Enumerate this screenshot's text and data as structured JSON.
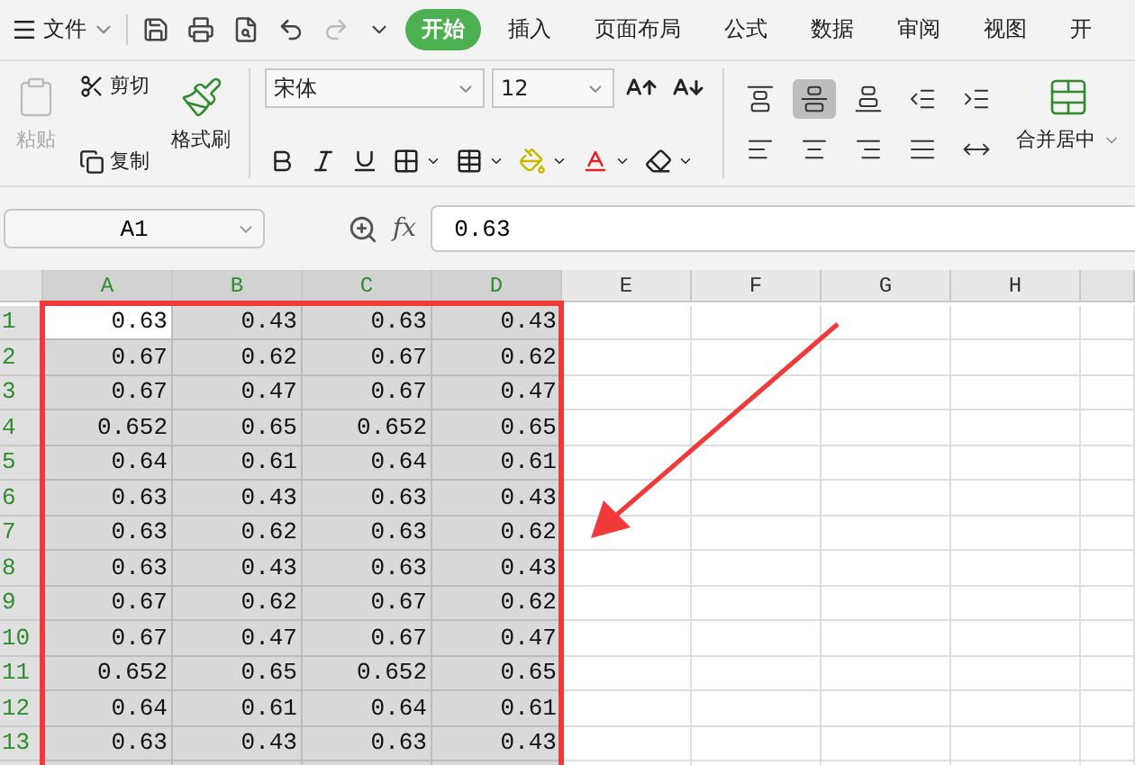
{
  "menu": {
    "file_label": "文件",
    "tabs": [
      {
        "label": "开始",
        "selected": true
      },
      {
        "label": "插入",
        "selected": false
      },
      {
        "label": "页面布局",
        "selected": false
      },
      {
        "label": "公式",
        "selected": false
      },
      {
        "label": "数据",
        "selected": false
      },
      {
        "label": "审阅",
        "selected": false
      },
      {
        "label": "视图",
        "selected": false
      },
      {
        "label": "开",
        "selected": false
      }
    ]
  },
  "clipboard": {
    "paste": {
      "label": "粘贴",
      "disabled": true
    },
    "cut": "剪切",
    "copy": "复制",
    "format_painter": "格式刷"
  },
  "font": {
    "name": "宋体",
    "size": "12"
  },
  "alignment": [
    {
      "kind": "top",
      "selected": false
    },
    {
      "kind": "middle",
      "selected": true
    },
    {
      "kind": "bottom",
      "selected": false
    },
    {
      "kind": "outdent",
      "selected": false
    },
    {
      "kind": "indent",
      "selected": false
    },
    {
      "kind": "left",
      "selected": false
    },
    {
      "kind": "center",
      "selected": false
    },
    {
      "kind": "right",
      "selected": false
    },
    {
      "kind": "justify",
      "selected": false
    },
    {
      "kind": "distribute",
      "selected": false
    }
  ],
  "merge_label": "合并居中",
  "formula_bar": {
    "name_box": "A1",
    "function_label": "fx",
    "value": "0.63"
  },
  "columns": [
    {
      "label": "A",
      "selected": true
    },
    {
      "label": "B",
      "selected": true
    },
    {
      "label": "C",
      "selected": true
    },
    {
      "label": "D",
      "selected": true
    },
    {
      "label": "E",
      "selected": false
    },
    {
      "label": "F",
      "selected": false
    },
    {
      "label": "G",
      "selected": false
    },
    {
      "label": "H",
      "selected": false
    }
  ],
  "rows": [
    {
      "label": "1",
      "selected": true,
      "cells": [
        {
          "value": "0.63",
          "active": true
        },
        {
          "value": "0.43",
          "active": false
        },
        {
          "value": "0.63",
          "active": false
        },
        {
          "value": "0.43",
          "active": false
        }
      ]
    },
    {
      "label": "2",
      "selected": true,
      "cells": [
        {
          "value": "0.67",
          "active": false
        },
        {
          "value": "0.62",
          "active": false
        },
        {
          "value": "0.67",
          "active": false
        },
        {
          "value": "0.62",
          "active": false
        }
      ]
    },
    {
      "label": "3",
      "selected": true,
      "cells": [
        {
          "value": "0.67",
          "active": false
        },
        {
          "value": "0.47",
          "active": false
        },
        {
          "value": "0.67",
          "active": false
        },
        {
          "value": "0.47",
          "active": false
        }
      ]
    },
    {
      "label": "4",
      "selected": true,
      "cells": [
        {
          "value": "0.652",
          "active": false
        },
        {
          "value": "0.65",
          "active": false
        },
        {
          "value": "0.652",
          "active": false
        },
        {
          "value": "0.65",
          "active": false
        }
      ]
    },
    {
      "label": "5",
      "selected": true,
      "cells": [
        {
          "value": "0.64",
          "active": false
        },
        {
          "value": "0.61",
          "active": false
        },
        {
          "value": "0.64",
          "active": false
        },
        {
          "value": "0.61",
          "active": false
        }
      ]
    },
    {
      "label": "6",
      "selected": true,
      "cells": [
        {
          "value": "0.63",
          "active": false
        },
        {
          "value": "0.43",
          "active": false
        },
        {
          "value": "0.63",
          "active": false
        },
        {
          "value": "0.43",
          "active": false
        }
      ]
    },
    {
      "label": "7",
      "selected": true,
      "cells": [
        {
          "value": "0.63",
          "active": false
        },
        {
          "value": "0.62",
          "active": false
        },
        {
          "value": "0.63",
          "active": false
        },
        {
          "value": "0.62",
          "active": false
        }
      ]
    },
    {
      "label": "8",
      "selected": true,
      "cells": [
        {
          "value": "0.63",
          "active": false
        },
        {
          "value": "0.43",
          "active": false
        },
        {
          "value": "0.63",
          "active": false
        },
        {
          "value": "0.43",
          "active": false
        }
      ]
    },
    {
      "label": "9",
      "selected": true,
      "cells": [
        {
          "value": "0.67",
          "active": false
        },
        {
          "value": "0.62",
          "active": false
        },
        {
          "value": "0.67",
          "active": false
        },
        {
          "value": "0.62",
          "active": false
        }
      ]
    },
    {
      "label": "10",
      "selected": true,
      "cells": [
        {
          "value": "0.67",
          "active": false
        },
        {
          "value": "0.47",
          "active": false
        },
        {
          "value": "0.67",
          "active": false
        },
        {
          "value": "0.47",
          "active": false
        }
      ]
    },
    {
      "label": "11",
      "selected": true,
      "cells": [
        {
          "value": "0.652",
          "active": false
        },
        {
          "value": "0.65",
          "active": false
        },
        {
          "value": "0.652",
          "active": false
        },
        {
          "value": "0.65",
          "active": false
        }
      ]
    },
    {
      "label": "12",
      "selected": true,
      "cells": [
        {
          "value": "0.64",
          "active": false
        },
        {
          "value": "0.61",
          "active": false
        },
        {
          "value": "0.64",
          "active": false
        },
        {
          "value": "0.61",
          "active": false
        }
      ]
    },
    {
      "label": "13",
      "selected": true,
      "cells": [
        {
          "value": "0.63",
          "active": false
        },
        {
          "value": "0.43",
          "active": false
        },
        {
          "value": "0.63",
          "active": false
        },
        {
          "value": "0.43",
          "active": false
        }
      ]
    }
  ]
}
